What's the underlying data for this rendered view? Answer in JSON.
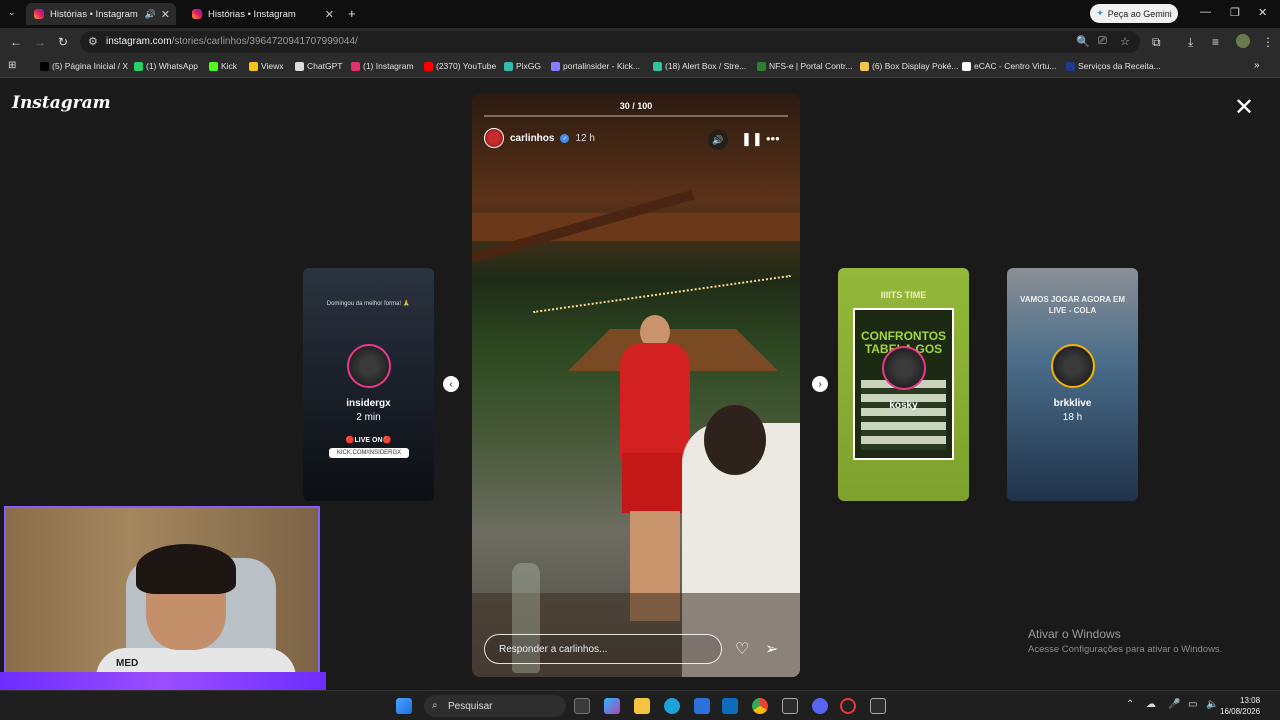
{
  "browser": {
    "tabs": [
      {
        "title": "Histórias • Instagram",
        "active": true
      },
      {
        "title": "Histórias • Instagram",
        "active": false
      }
    ],
    "new_tab": "+",
    "gemini_label": "Peça ao Gemini",
    "url_host": "instagram.com",
    "url_path": "/stories/carlinhos/3964720941707999044/",
    "bookmarks": [
      {
        "label": "(5) Página Inicial / X",
        "color": "#000000"
      },
      {
        "label": "(1) WhatsApp",
        "color": "#25d366"
      },
      {
        "label": "Kick",
        "color": "#53fc18"
      },
      {
        "label": "Viewx",
        "color": "#f5c518"
      },
      {
        "label": "ChatGPT",
        "color": "#dddddd"
      },
      {
        "label": "(1) Instagram",
        "color": "#e1306c"
      },
      {
        "label": "(2370) YouTube",
        "color": "#ff0000"
      },
      {
        "label": "PixGG",
        "color": "#32bcad"
      },
      {
        "label": "portalinsider - Kick...",
        "color": "#8a7cff"
      },
      {
        "label": "(18) Alert Box / Stre...",
        "color": "#31c3a2"
      },
      {
        "label": "NFS-e | Portal Contr...",
        "color": "#2e7d32"
      },
      {
        "label": "(6) Box Display Poké...",
        "color": "#f2c94c"
      },
      {
        "label": "eCAC - Centro Virtu...",
        "color": "#ffffff"
      },
      {
        "label": "Serviços da Receita...",
        "color": "#1e3a8a"
      }
    ]
  },
  "instagram": {
    "logo": "Instagram",
    "close_label": "✕",
    "story": {
      "counter": "30 / 100",
      "progress": 0.0,
      "username": "carlinhos",
      "time": "12 h",
      "reply_placeholder": "Responder a carlinhos..."
    },
    "previews": [
      {
        "name": "insidergx",
        "time": "2 min",
        "top_text": "Domingou da melhor forma! 🙏",
        "badge": "🔴LIVE ON🔴",
        "link": "KICK.COM/INSIDERGX"
      },
      {
        "name": "kosky",
        "time": "",
        "top_text": "IIIITS TIME",
        "headline": "CONFRONTOS TABELA GOS"
      },
      {
        "name": "brkklive",
        "time": "18 h",
        "top_text": "VAMOS JOGAR AGORA EM LIVE - COLA"
      }
    ]
  },
  "windows": {
    "activate_title": "Ativar o Windows",
    "activate_sub": "Acesse Configurações para ativar o Windows.",
    "search_placeholder": "Pesquisar",
    "time": "13:08",
    "date": "16/08/2026"
  },
  "webcam": {
    "shirt_text": "MED"
  }
}
